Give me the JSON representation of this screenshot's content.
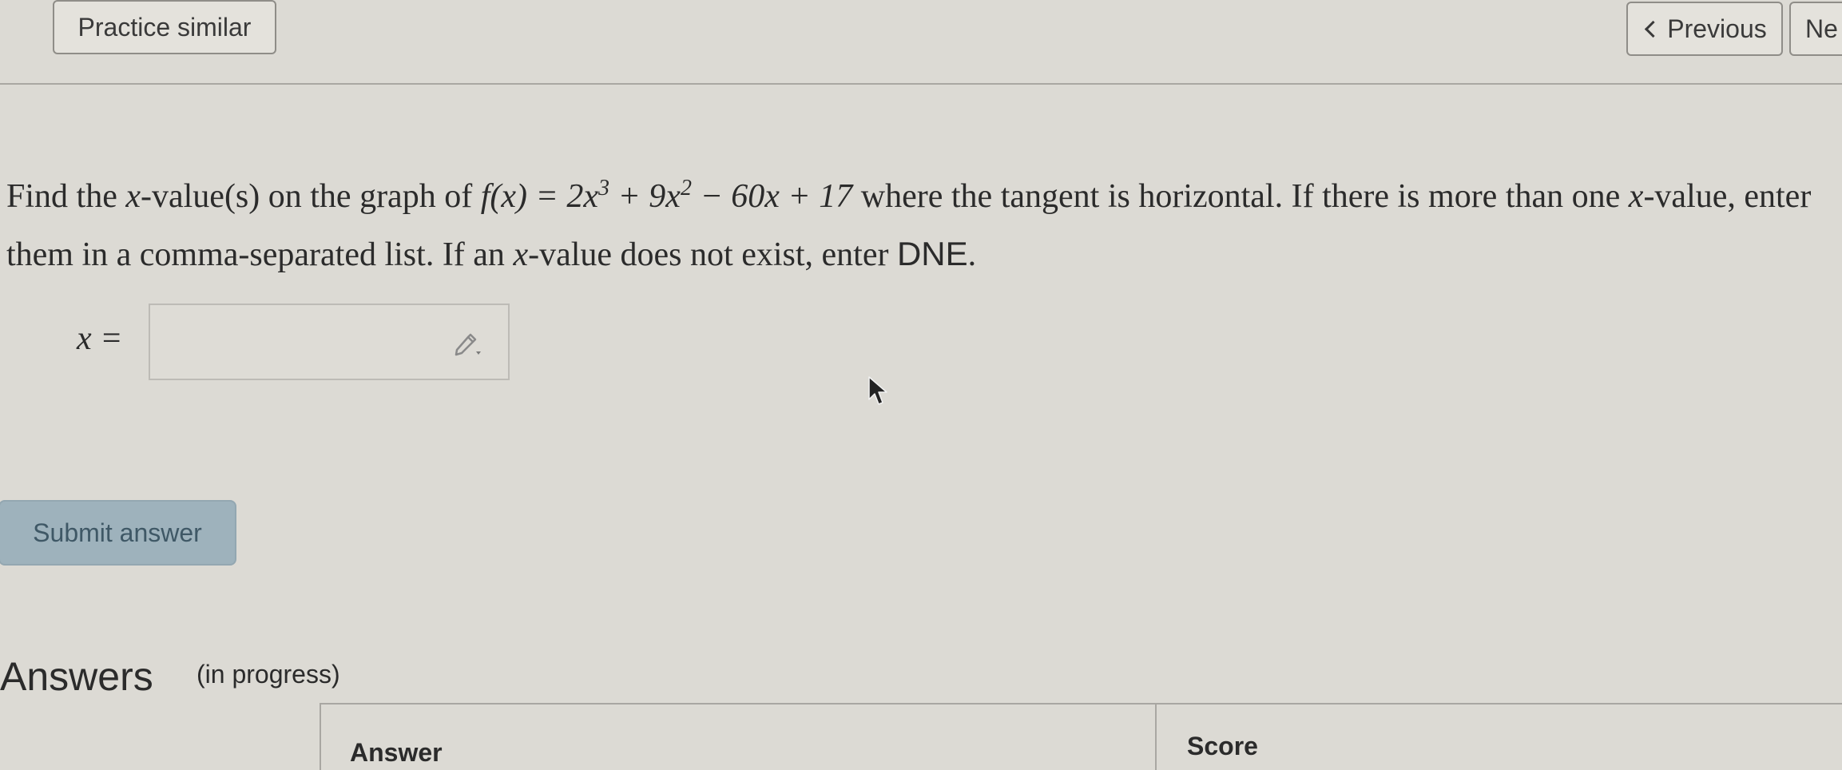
{
  "topbar": {
    "practice_label": "Practice similar",
    "previous_label": "Previous",
    "next_label": "Ne"
  },
  "question": {
    "part1": "Find the ",
    "var_x": "x",
    "part2": "-value(s) on the graph of ",
    "fx": "f(x) = 2x",
    "exp1": "3",
    "mid": " + 9x",
    "exp2": "2",
    "tail": " − 60x + 17",
    "part3": " where the tangent is horizontal. If there is more than one ",
    "part4": "-value, enter them in a comma-separated list. If an ",
    "part5": "-value does not exist, enter ",
    "dne": "DNE",
    "period": "."
  },
  "input": {
    "label": "x =",
    "value": ""
  },
  "submit_label": "Submit answer",
  "answers": {
    "heading": "Answers",
    "status": "(in progress)",
    "columns": [
      "Answer",
      "Score"
    ]
  },
  "icons": {
    "pencil": "pencil-dropdown-icon",
    "chevron": "chevron-left-icon",
    "cursor": "mouse-cursor-icon"
  }
}
